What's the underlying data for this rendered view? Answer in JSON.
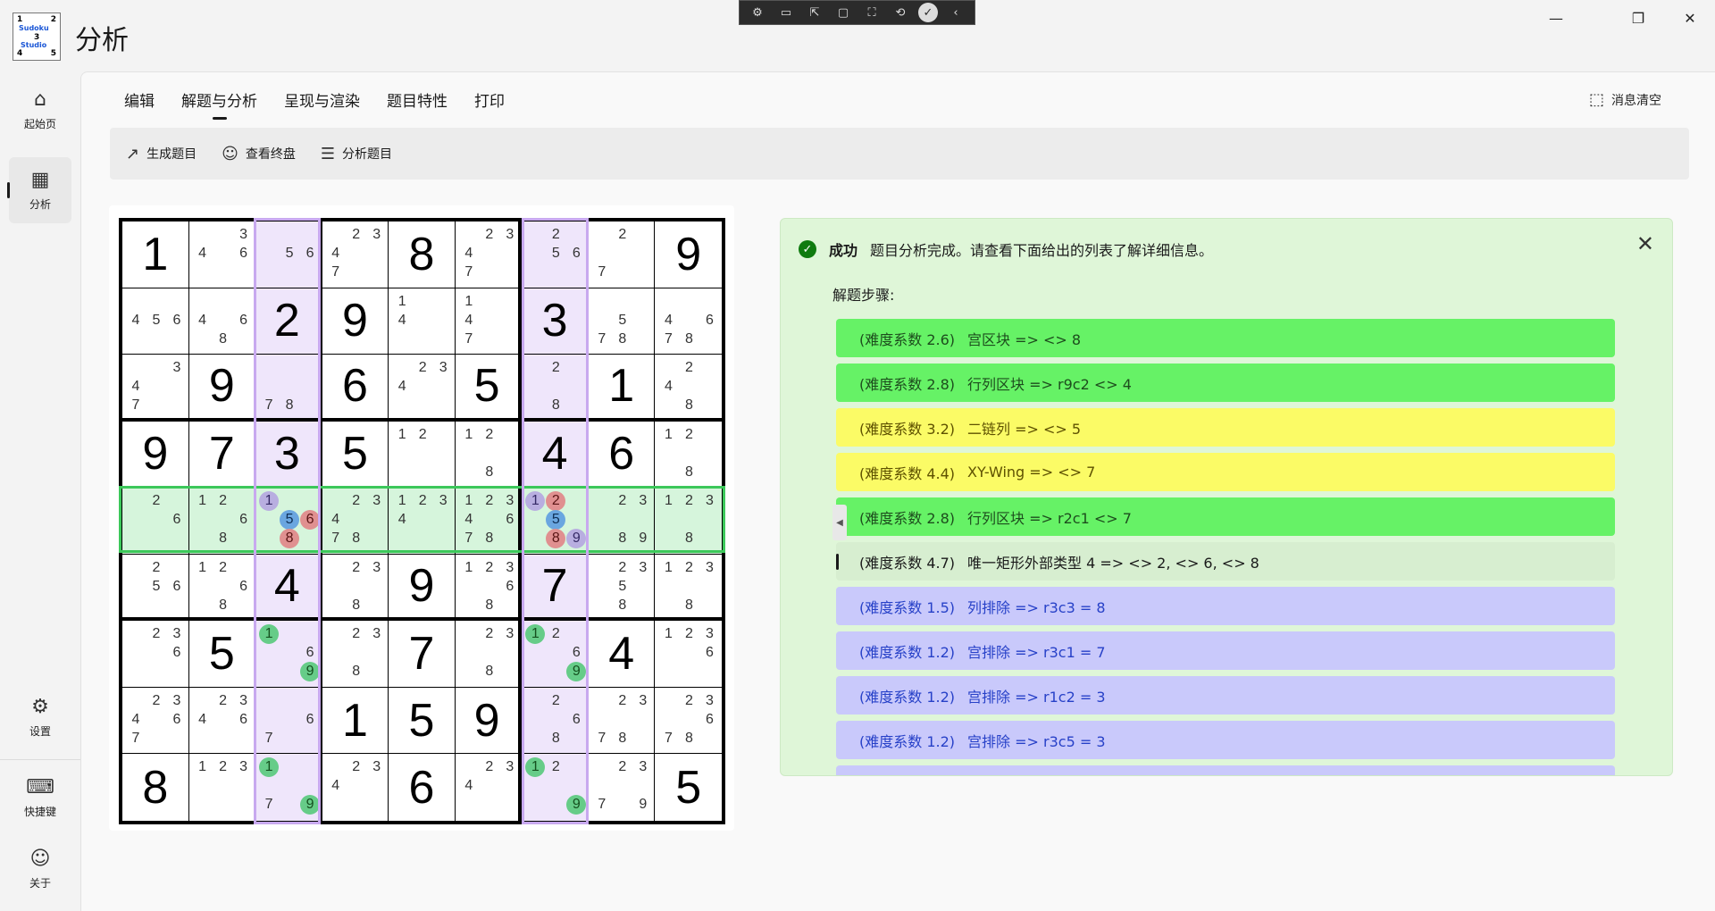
{
  "window": {
    "title": "分析",
    "logo_text": [
      "1",
      "2",
      "Sudoku",
      "3",
      "Studio",
      "4",
      "5"
    ],
    "controls": {
      "minimize": "—",
      "restore": "❐",
      "close": "✕"
    }
  },
  "capture_toolbar": {
    "icons": [
      "⚙",
      "▭",
      "⇱",
      "▢",
      "⛶",
      "⟲",
      "✓",
      "‹"
    ]
  },
  "nav": {
    "top": [
      {
        "label": "起始页",
        "icon": "home-icon",
        "glyph": "⌂"
      },
      {
        "label": "分析",
        "icon": "grid-icon",
        "glyph": "▦"
      }
    ],
    "bottom": [
      {
        "label": "设置",
        "icon": "gear-icon",
        "glyph": "⚙"
      },
      {
        "label": "快捷键",
        "icon": "keyboard-icon",
        "glyph": "⌨"
      },
      {
        "label": "关于",
        "icon": "people-icon",
        "glyph": "☺"
      }
    ]
  },
  "tabs": [
    "编辑",
    "解题与分析",
    "呈现与渲染",
    "题目特性",
    "打印"
  ],
  "clear_messages": "消息清空",
  "toolbar": [
    {
      "label": "生成题目",
      "icon": "arrow-up-right-icon",
      "glyph": "↗"
    },
    {
      "label": "查看终盘",
      "icon": "smiley-icon",
      "glyph": "☺"
    },
    {
      "label": "分析题目",
      "icon": "list-icon",
      "glyph": "☰"
    }
  ],
  "sudoku": {
    "highlight_row": 4,
    "highlight_cols": [
      2,
      6
    ],
    "cells": [
      [
        {
          "v": "1"
        },
        {
          "c": [
            "3",
            "4",
            "6"
          ]
        },
        {
          "c": [
            "5",
            "6"
          ]
        },
        {
          "c": [
            "2",
            "3",
            "4",
            "7"
          ]
        },
        {
          "v": "8"
        },
        {
          "c": [
            "2",
            "3",
            "4",
            "7"
          ]
        },
        {
          "c": [
            "2",
            "5",
            "6"
          ]
        },
        {
          "c": [
            "2",
            "7"
          ]
        },
        {
          "v": "9"
        }
      ],
      [
        {
          "c": [
            "4",
            "5",
            "6"
          ]
        },
        {
          "c": [
            "4",
            "6",
            "8"
          ]
        },
        {
          "v": "2"
        },
        {
          "v": "9"
        },
        {
          "c": [
            "1",
            "4"
          ]
        },
        {
          "c": [
            "1",
            "4",
            "7"
          ]
        },
        {
          "v": "3"
        },
        {
          "c": [
            "5",
            "7",
            "8"
          ]
        },
        {
          "c": [
            "4",
            "6",
            "7",
            "8"
          ]
        }
      ],
      [
        {
          "c": [
            "3",
            "4",
            "7"
          ]
        },
        {
          "v": "9"
        },
        {
          "c": [
            "7",
            "8"
          ]
        },
        {
          "v": "6"
        },
        {
          "c": [
            "2",
            "3",
            "4"
          ]
        },
        {
          "v": "5"
        },
        {
          "c": [
            "2",
            "8"
          ]
        },
        {
          "v": "1"
        },
        {
          "c": [
            "2",
            "4",
            "8"
          ]
        }
      ],
      [
        {
          "v": "9"
        },
        {
          "v": "7"
        },
        {
          "v": "3"
        },
        {
          "v": "5"
        },
        {
          "c": [
            "1",
            "2"
          ]
        },
        {
          "c": [
            "1",
            "2",
            "8"
          ]
        },
        {
          "v": "4"
        },
        {
          "v": "6"
        },
        {
          "c": [
            "1",
            "2",
            "8"
          ]
        }
      ],
      [
        {
          "c": [
            "2",
            "6"
          ]
        },
        {
          "c": [
            "1",
            "2",
            "6",
            "8"
          ]
        },
        {
          "c": [
            "1",
            "5",
            "6",
            "8"
          ],
          "m": {
            "1": "p",
            "5": "b",
            "6": "r",
            "8": "r"
          }
        },
        {
          "c": [
            "2",
            "3",
            "4",
            "7",
            "8"
          ]
        },
        {
          "c": [
            "1",
            "2",
            "3",
            "4"
          ]
        },
        {
          "c": [
            "1",
            "2",
            "3",
            "4",
            "6",
            "7",
            "8"
          ]
        },
        {
          "c": [
            "1",
            "2",
            "5",
            "8",
            "9"
          ],
          "m": {
            "1": "p",
            "2": "r",
            "5": "b",
            "8": "r",
            "9": "p"
          }
        },
        {
          "c": [
            "2",
            "3",
            "8",
            "9"
          ]
        },
        {
          "c": [
            "1",
            "2",
            "3",
            "8"
          ]
        }
      ],
      [
        {
          "c": [
            "2",
            "5",
            "6"
          ]
        },
        {
          "c": [
            "1",
            "2",
            "6",
            "8"
          ]
        },
        {
          "v": "4"
        },
        {
          "c": [
            "2",
            "3",
            "8"
          ]
        },
        {
          "v": "9"
        },
        {
          "c": [
            "1",
            "2",
            "3",
            "6",
            "8"
          ]
        },
        {
          "v": "7"
        },
        {
          "c": [
            "2",
            "3",
            "5",
            "8"
          ]
        },
        {
          "c": [
            "1",
            "2",
            "3",
            "8"
          ]
        }
      ],
      [
        {
          "c": [
            "2",
            "3",
            "6"
          ]
        },
        {
          "v": "5"
        },
        {
          "c": [
            "1",
            "6",
            "9"
          ],
          "m": {
            "1": "g",
            "9": "g"
          }
        },
        {
          "c": [
            "2",
            "3",
            "8"
          ]
        },
        {
          "v": "7"
        },
        {
          "c": [
            "2",
            "3",
            "8"
          ]
        },
        {
          "c": [
            "1",
            "2",
            "6",
            "9"
          ],
          "m": {
            "1": "g",
            "9": "g"
          }
        },
        {
          "v": "4"
        },
        {
          "c": [
            "1",
            "2",
            "3",
            "6"
          ]
        }
      ],
      [
        {
          "c": [
            "2",
            "3",
            "4",
            "6",
            "7"
          ]
        },
        {
          "c": [
            "2",
            "3",
            "4",
            "6"
          ]
        },
        {
          "c": [
            "6",
            "7"
          ]
        },
        {
          "v": "1"
        },
        {
          "v": "5"
        },
        {
          "v": "9"
        },
        {
          "c": [
            "2",
            "6",
            "8"
          ]
        },
        {
          "c": [
            "2",
            "3",
            "7",
            "8"
          ]
        },
        {
          "c": [
            "2",
            "3",
            "6",
            "7",
            "8"
          ]
        }
      ],
      [
        {
          "v": "8"
        },
        {
          "c": [
            "1",
            "2",
            "3"
          ]
        },
        {
          "c": [
            "1",
            "7",
            "9"
          ],
          "m": {
            "1": "g",
            "9": "g"
          }
        },
        {
          "c": [
            "2",
            "3",
            "4"
          ]
        },
        {
          "v": "6"
        },
        {
          "c": [
            "2",
            "3",
            "4"
          ]
        },
        {
          "c": [
            "1",
            "2",
            "9"
          ],
          "m": {
            "1": "g",
            "9": "g"
          }
        },
        {
          "c": [
            "2",
            "3",
            "7",
            "9"
          ]
        },
        {
          "v": "5"
        }
      ]
    ]
  },
  "info": {
    "title": "成功",
    "message": "题目分析完成。请查看下面给出的列表了解详细信息。",
    "close": "✕",
    "steps_label": "解题步骤:",
    "steps": [
      {
        "diff": "(难度系数 2.6)",
        "text": "宫区块 =>  <> 8",
        "color": "green"
      },
      {
        "diff": "(难度系数 2.8)",
        "text": "行列区块 => r9c2 <> 4",
        "color": "green"
      },
      {
        "diff": "(难度系数 3.2)",
        "text": "二链列 =>  <> 5",
        "color": "yellow"
      },
      {
        "diff": "(难度系数 4.4)",
        "text": "XY-Wing =>  <> 7",
        "color": "yellow"
      },
      {
        "diff": "(难度系数 2.8)",
        "text": "行列区块 => r2c1 <> 7",
        "color": "green"
      },
      {
        "diff": "(难度系数 4.7)",
        "text": "唯一矩形外部类型 4 =>  <> 2,  <> 6,  <> 8",
        "color": "gray",
        "selected": true
      },
      {
        "diff": "(难度系数 1.5)",
        "text": "列排除 => r3c3 = 8",
        "color": "blue"
      },
      {
        "diff": "(难度系数 1.2)",
        "text": "宫排除 => r3c1 = 7",
        "color": "blue"
      },
      {
        "diff": "(难度系数 1.2)",
        "text": "宫排除 => r1c2 = 3",
        "color": "blue"
      },
      {
        "diff": "(难度系数 1.2)",
        "text": "宫排除 => r3c5 = 3",
        "color": "blue"
      },
      {
        "diff": "",
        "text": "",
        "color": "blue"
      }
    ]
  }
}
